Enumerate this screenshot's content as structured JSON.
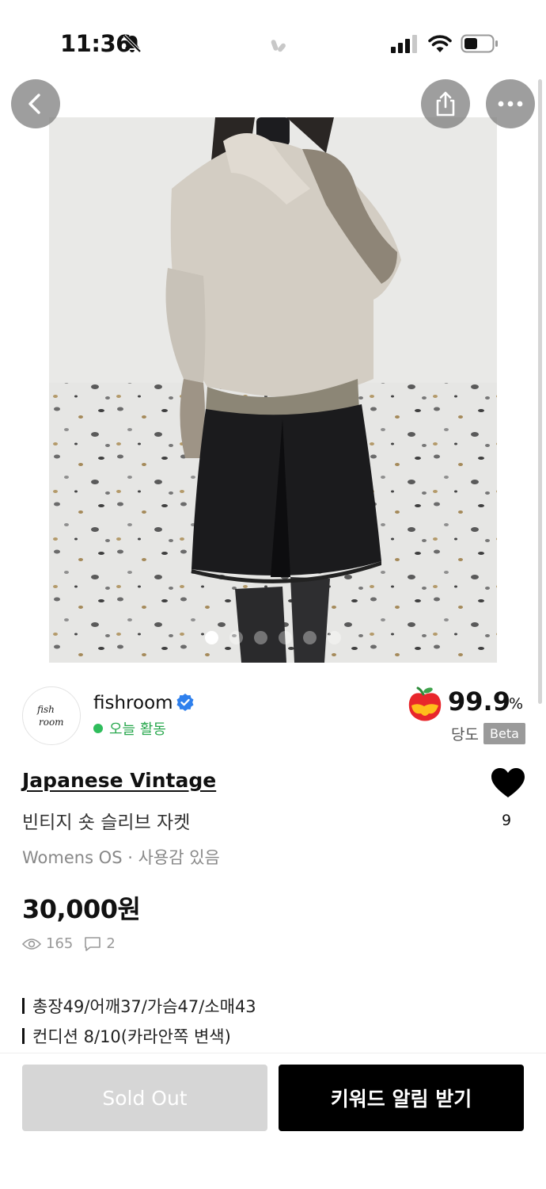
{
  "status_bar": {
    "time": "11:36"
  },
  "gallery": {
    "image_count": 6,
    "active_index": 0
  },
  "seller": {
    "avatar_text": "fish room",
    "name": "fishroom",
    "verified": true,
    "activity": "오늘 활동",
    "score": "99.9",
    "score_unit": "%",
    "score_label": "당도",
    "score_badge": "Beta"
  },
  "product": {
    "brand": "Japanese Vintage",
    "title": "빈티지 숏 슬리브 자켓",
    "meta": "Womens OS · 사용감 있음",
    "price": "30,000원",
    "views": "165",
    "comments": "2",
    "likes": "9",
    "description": [
      "총장49/어깨37/가슴47/소매43",
      "컨디션 8/10(카라안쪽 변색)"
    ]
  },
  "actions": {
    "sold_out": "Sold Out",
    "keyword_alert": "키워드 알림 받기"
  },
  "colors": {
    "accent": "#000000",
    "active_green": "#2fbd5c",
    "verified_blue": "#2f80ed"
  }
}
